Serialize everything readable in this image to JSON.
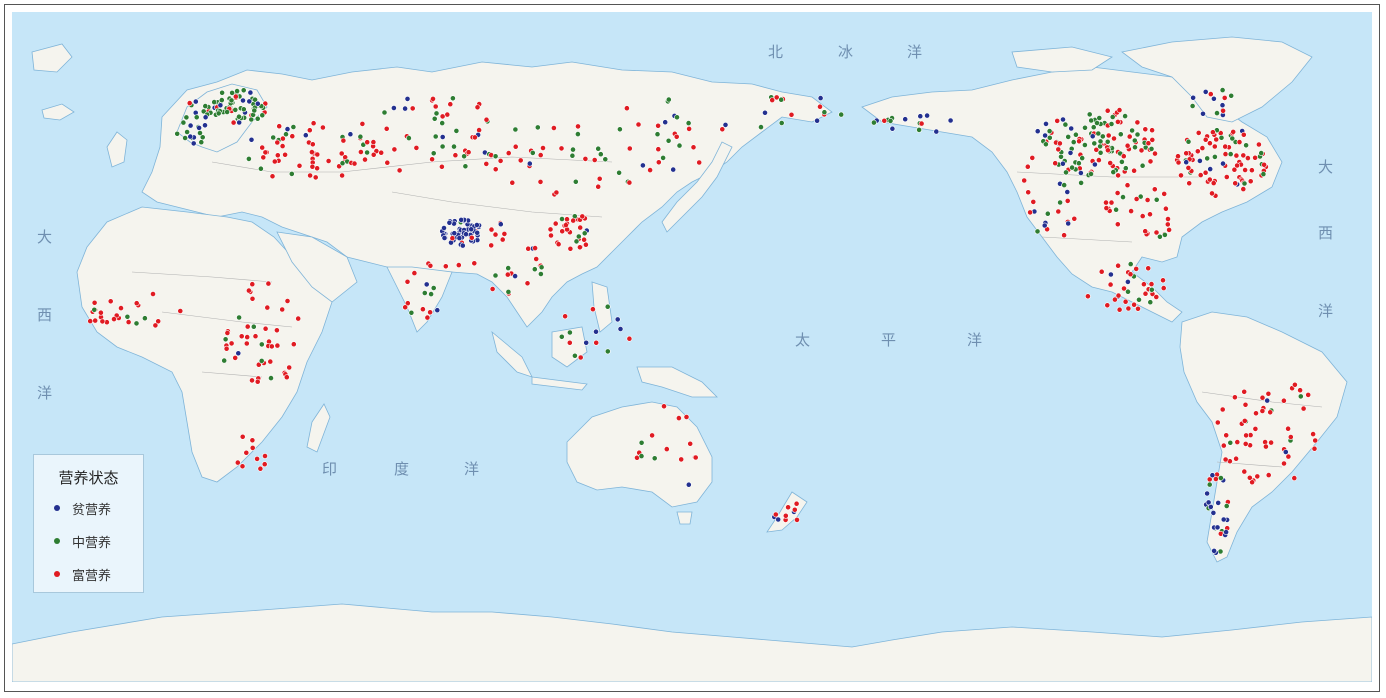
{
  "legend": {
    "title": "营养状态",
    "items": [
      {
        "key": "oligo",
        "label": "贫营养",
        "color": "#23308f"
      },
      {
        "key": "meso",
        "label": "中营养",
        "color": "#2e7d32"
      },
      {
        "key": "eu",
        "label": "富营养",
        "color": "#e01b22"
      }
    ]
  },
  "ocean_labels": {
    "atlantic_west_1": "大",
    "atlantic_west_2": "西",
    "atlantic_west_3": "洋",
    "atlantic_east_1": "大",
    "atlantic_east_2": "西",
    "atlantic_east_3": "洋",
    "arctic_1": "北",
    "arctic_2": "冰",
    "arctic_3": "洋",
    "pacific_1": "太",
    "pacific_2": "平",
    "pacific_3": "洋",
    "indian_1": "印",
    "indian_2": "度",
    "indian_3": "洋"
  },
  "colors": {
    "ocean": "#c6e6f8",
    "land": "#f5f4ee",
    "border": "#b0b0b0",
    "coast": "#7fb4d8"
  }
}
